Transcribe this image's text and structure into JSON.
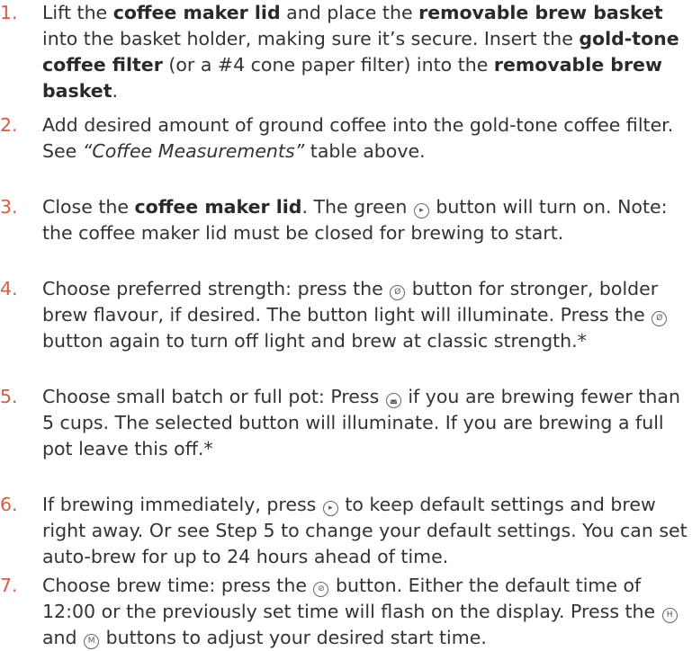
{
  "steps": [
    {
      "number": "1.",
      "segments": [
        {
          "t": "Lift the "
        },
        {
          "t": "coffee maker lid",
          "b": true
        },
        {
          "t": " and place the "
        },
        {
          "t": "removable brew basket",
          "b": true
        },
        {
          "t": " into the basket holder, making sure it’s secure. Insert the "
        },
        {
          "t": "gold-tone coffee filter",
          "b": true
        },
        {
          "t": " (or a #4 cone paper filter) into the "
        },
        {
          "t": "removable brew basket",
          "b": true
        },
        {
          "t": "."
        }
      ]
    },
    {
      "number": "2.",
      "segments": [
        {
          "t": "Add desired amount of ground coffee into the gold-tone coffee filter. See "
        },
        {
          "t": "“Coffee Measurements”",
          "i": true
        },
        {
          "t": " table above."
        }
      ]
    },
    {
      "number": "3.",
      "segments": [
        {
          "t": "Close the "
        },
        {
          "t": "coffee maker lid",
          "b": true
        },
        {
          "t": ". The green "
        },
        {
          "icon": "start-button-icon",
          "glyph": "▸"
        },
        {
          "t": " button will turn on. Note: the coffee maker lid must be closed for brewing to start."
        }
      ]
    },
    {
      "number": "4.",
      "segments": [
        {
          "t": "Choose preferred strength: press the "
        },
        {
          "icon": "bold-strength-icon",
          "glyph": "Ø"
        },
        {
          "t": " button for stronger, bolder brew flavour, if desired. The button light will illuminate. Press the "
        },
        {
          "icon": "bold-strength-icon",
          "glyph": "Ø"
        },
        {
          "t": " button again to turn off light and brew at classic strength.*"
        }
      ]
    },
    {
      "number": "5.",
      "segments": [
        {
          "t": "Choose small batch or full pot: Press "
        },
        {
          "icon": "small-batch-icon",
          "glyph": "◛"
        },
        {
          "t": " if you are brewing fewer than 5 cups. The selected button will illuminate. If you are brewing a full pot leave this off.*"
        }
      ]
    },
    {
      "number": "6.",
      "segments": [
        {
          "t": "If brewing immediately, press "
        },
        {
          "icon": "start-button-icon",
          "glyph": "▸"
        },
        {
          "t": " to keep default settings and brew right away. Or see Step 5 to change your default settings. You can set auto-brew for up to 24 hours ahead of time."
        }
      ]
    },
    {
      "number": "7.",
      "segments": [
        {
          "t": "Choose brew time: press the "
        },
        {
          "icon": "program-brew-icon",
          "glyph": "⊘"
        },
        {
          "t": " button. Either the default time of 12:00 or the previously set time will flash on the display. Press the "
        },
        {
          "icon": "hour-button-icon",
          "glyph": "H"
        },
        {
          "t": " and "
        },
        {
          "icon": "minute-button-icon",
          "glyph": "M"
        },
        {
          "t": " buttons to adjust your desired start time."
        }
      ]
    }
  ]
}
